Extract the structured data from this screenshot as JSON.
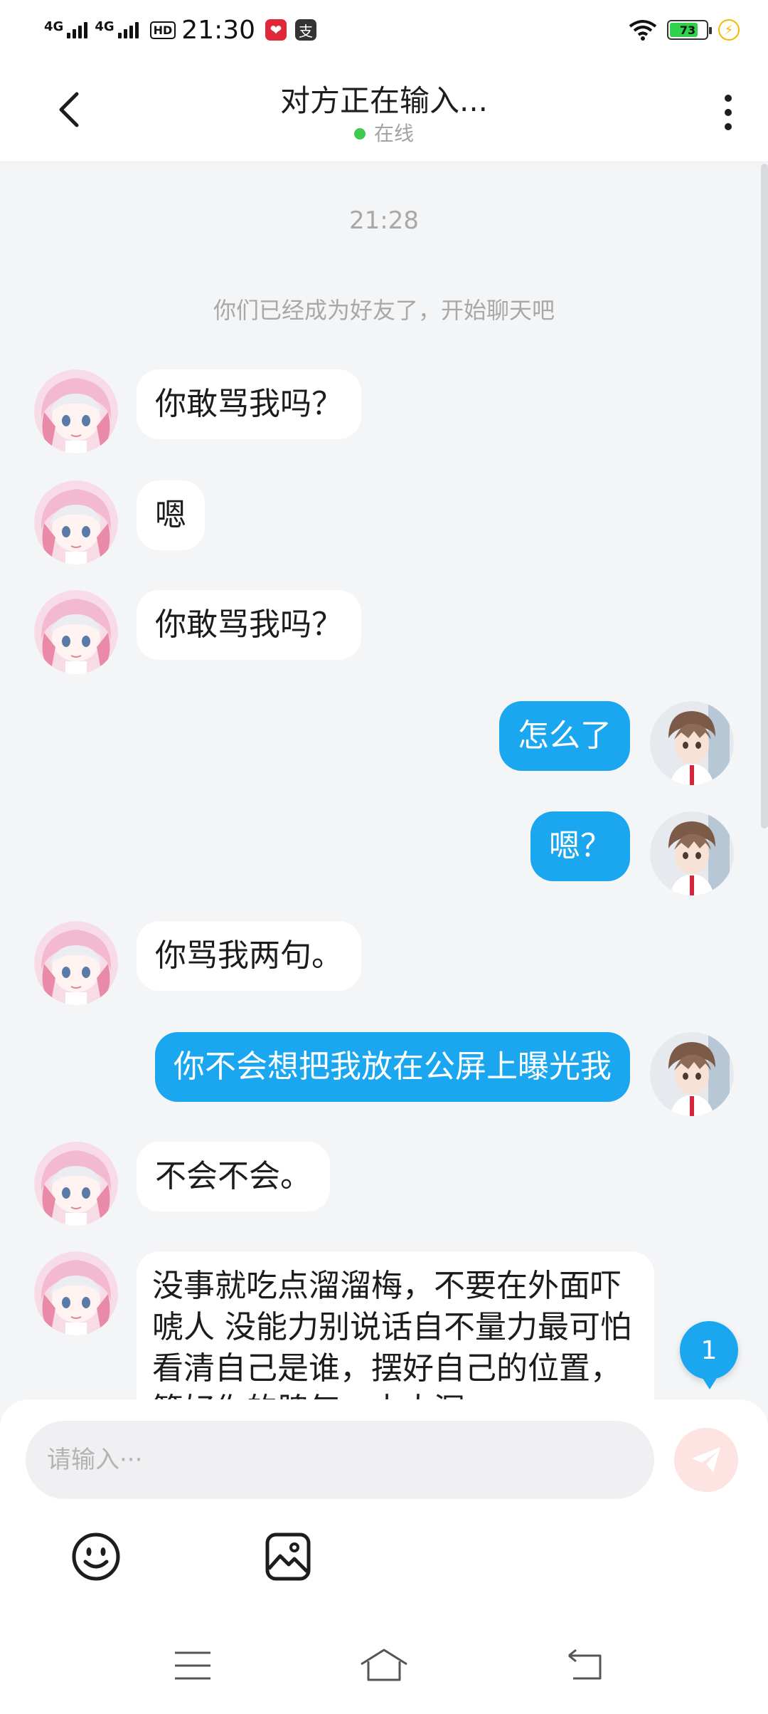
{
  "status_bar": {
    "network_1": "4G",
    "network_2": "4G",
    "hd": "HD",
    "time": "21:30",
    "battery_level": "73",
    "icons": [
      "wifi-icon",
      "battery-icon",
      "charging-icon"
    ]
  },
  "header": {
    "title": "对方正在输入...",
    "status": "在线",
    "status_color": "#3ec94f"
  },
  "chat": {
    "timestamp": "21:28",
    "system_message": "你们已经成为好友了，开始聊天吧",
    "messages": [
      {
        "side": "in",
        "text": "你敢骂我吗？"
      },
      {
        "side": "in",
        "text": "嗯"
      },
      {
        "side": "in",
        "text": "你敢骂我吗？"
      },
      {
        "side": "out",
        "text": "怎么了"
      },
      {
        "side": "out",
        "text": "嗯？"
      },
      {
        "side": "in",
        "text": "你骂我两句。"
      },
      {
        "side": "out",
        "text": "你不会想把我放在公屏上曝光我"
      },
      {
        "side": "in",
        "text": "不会不会。"
      },
      {
        "side": "in",
        "text": "没事就吃点溜溜梅，不要在外面吓唬人 没能力别说话自不量力最可怕看清自己是谁，摆好自己的位置，管好你的脾气，水太深"
      }
    ],
    "unread_count": "1",
    "accent_color": "#1aa7ef"
  },
  "composer": {
    "placeholder": "请输入···"
  }
}
